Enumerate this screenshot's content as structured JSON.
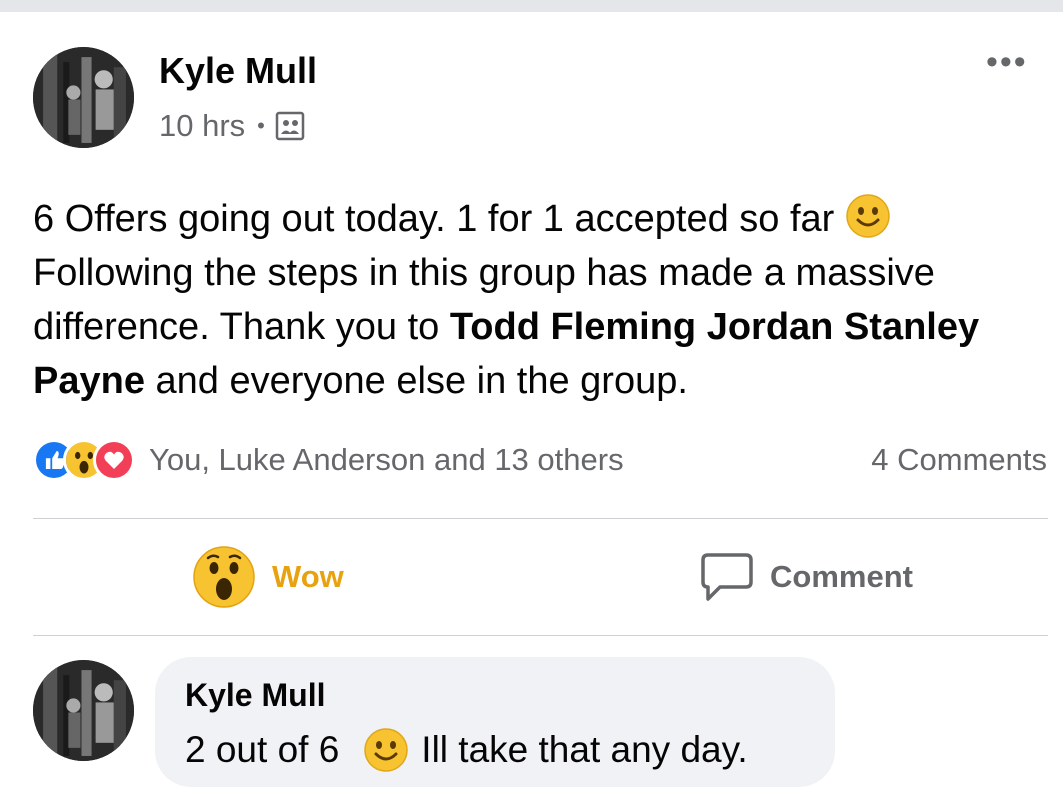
{
  "post": {
    "author": "Kyle Mull",
    "time": "10 hrs",
    "separator": "•",
    "audience_icon": "group-icon",
    "more_label": "•••",
    "text_part1": "6 Offers going out today. 1 for 1 accepted so far ",
    "text_part2": "Following the steps in this group has made a massive difference. Thank you to ",
    "mention": "Todd Fleming Jordan Stanley Payne",
    "text_part3": " and everyone else in the group.",
    "inline_emoji": "smile-emoji"
  },
  "reactions": {
    "icons": [
      "like-icon",
      "wow-icon",
      "love-icon"
    ],
    "summary": "You, Luke Anderson and 13 others",
    "comments_count": "4 Comments"
  },
  "actions": {
    "reaction_label": "Wow",
    "reaction_color": "#e9a20f",
    "comment_label": "Comment"
  },
  "comment": {
    "author": "Kyle Mull",
    "text_before": "2 out of 6",
    "text_after": "Ill take that any day."
  },
  "colors": {
    "secondary_text": "#65676b",
    "bubble_bg": "#f0f2f5",
    "like_blue": "#1877f2",
    "love_red": "#f33e58"
  }
}
